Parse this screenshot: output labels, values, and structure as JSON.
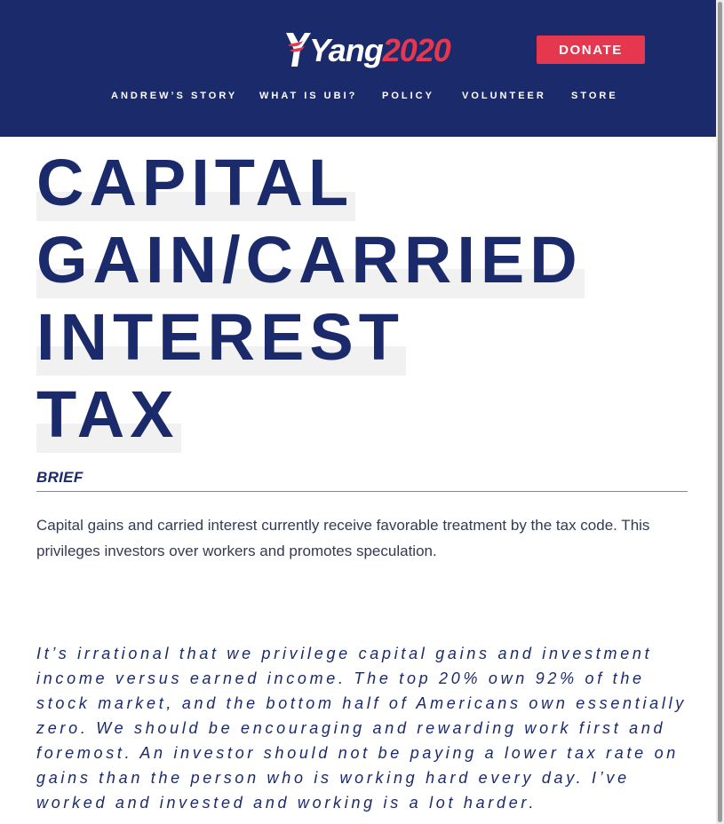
{
  "header": {
    "logo": {
      "yang": "Yang",
      "year": "2020"
    },
    "donate_label": "DONATE",
    "nav": [
      "ANDREW’S STORY",
      "WHAT IS UBI?",
      "POLICY",
      "VOLUNTEER",
      "STORE"
    ]
  },
  "page": {
    "title_lines": [
      "CAPITAL",
      "GAIN/CARRIED",
      "INTEREST",
      "TAX"
    ],
    "brief_heading": "BRIEF",
    "summary": "Capital gains and carried interest currently receive favorable treatment by the tax code. This privileges investors over workers and promotes speculation.",
    "quote": "It’s irrational that we privilege capital gains and investment income versus earned income. The top 20% own 92% of the stock market, and the bottom half of Americans own essentially zero. We should be encouraging and rewarding work first and foremost. An investor should not be paying a lower tax rate on gains than the person who is working hard every day. I’ve worked and invested and working is a lot harder."
  },
  "colors": {
    "navy": "#1b2a6b",
    "red": "#e5384f",
    "highlight": "#f1f1f1",
    "text": "#333b53"
  },
  "icons": {
    "logo_mark": "yang-logo-icon"
  }
}
